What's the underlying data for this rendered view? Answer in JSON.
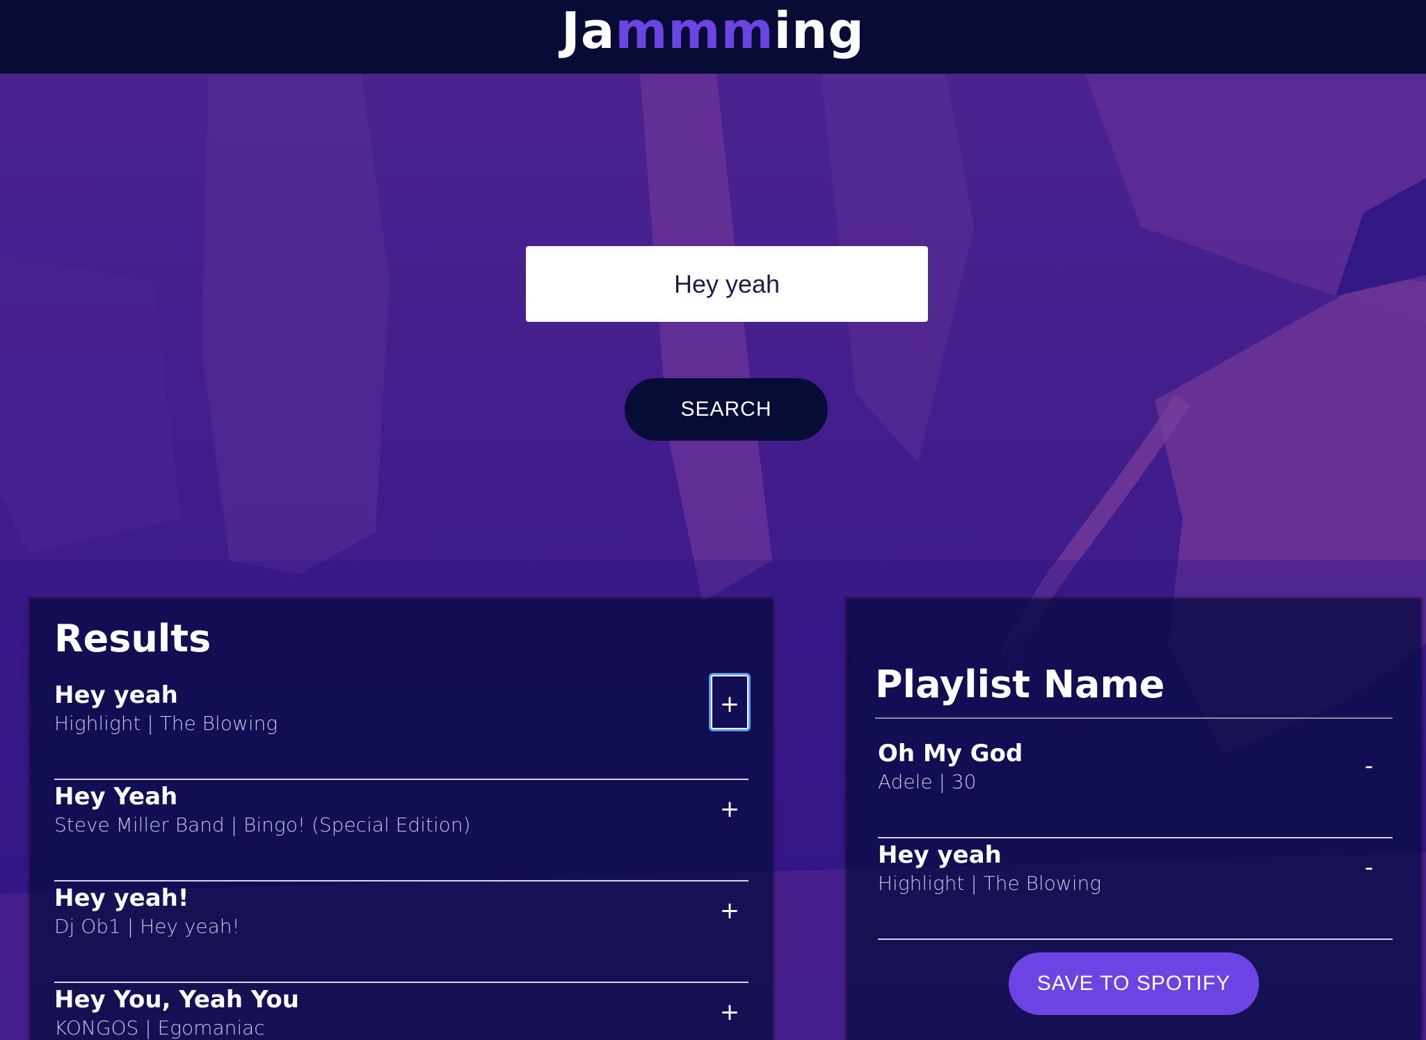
{
  "header": {
    "logo_prefix": "Ja",
    "logo_accent": "mmm",
    "logo_suffix": "ing"
  },
  "search": {
    "value": "Hey yeah",
    "button_label": "SEARCH"
  },
  "results": {
    "title": "Results",
    "tracks": [
      {
        "name": "Hey yeah",
        "info": "Highlight | The Blowing",
        "action": "+"
      },
      {
        "name": "Hey Yeah",
        "info": "Steve Miller Band | Bingo! (Special Edition)",
        "action": "+"
      },
      {
        "name": "Hey yeah!",
        "info": "Dj Ob1 | Hey yeah!",
        "action": "+"
      },
      {
        "name": "Hey You, Yeah You",
        "info": "KONGOS | Egomaniac",
        "action": "+"
      }
    ]
  },
  "playlist": {
    "name": "Playlist Name",
    "tracks": [
      {
        "name": "Oh My God",
        "info": "Adele | 30",
        "action": "-"
      },
      {
        "name": "Hey yeah",
        "info": "Highlight | The Blowing",
        "action": "-"
      }
    ],
    "save_label": "SAVE TO SPOTIFY"
  },
  "colors": {
    "header_bg": "#070b36",
    "accent": "#6c44e4",
    "panel_bg": "#0a0c46",
    "background": "#3a1b86"
  }
}
